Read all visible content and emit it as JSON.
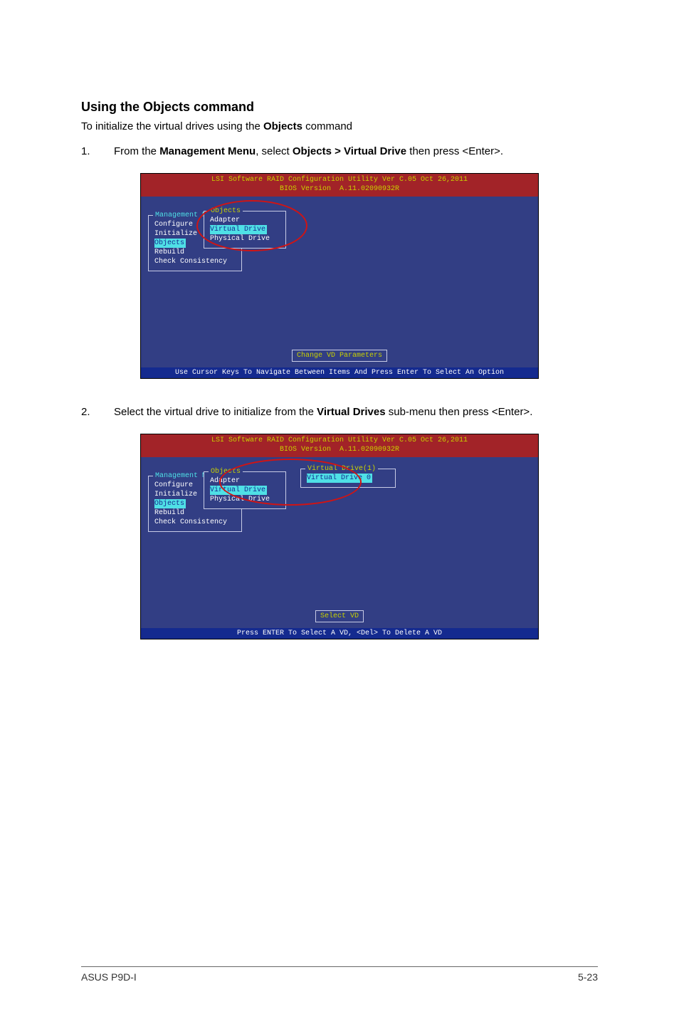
{
  "heading": "Using the Objects command",
  "intro_pre": "To initialize the virtual drives using the ",
  "intro_bold": "Objects",
  "intro_post": " command",
  "step1": {
    "num": "1.",
    "t1": "From the ",
    "b1": "Management Menu",
    "t2": ", select ",
    "b2": "Objects > Virtual Drive",
    "t3": " then press <Enter>."
  },
  "step2": {
    "num": "2.",
    "t1": "Select the virtual drive to initialize from the ",
    "b1": "Virtual Drives",
    "t2": " sub-menu then press <Enter>."
  },
  "bios": {
    "title_line1": "LSI Software RAID Configuration Utility Ver C.05 Oct 26,2011",
    "title_line2": "BIOS Version  A.11.02090932R",
    "mgmt_title": "Management Menu",
    "mgmt_items": {
      "configure": "Configure",
      "initialize": "Initialize",
      "objects": "Objects",
      "rebuild": "Rebuild",
      "check": "Check Consistency"
    },
    "objects_title": "Objects",
    "objects_items": {
      "adapter": "Adapter",
      "virtual_drive": "Virtual Drive",
      "physical_drive": "Physical Drive"
    },
    "vd_title": "Virtual Drive(1)",
    "vd_item": "Virtual Drive 0",
    "hint1": "Change VD Parameters",
    "footer1": "Use Cursor Keys To Navigate Between Items And Press Enter To Select An Option",
    "hint2": "Select VD",
    "footer2": "Press ENTER To Select A VD, <Del> To Delete A VD"
  },
  "footer": {
    "left": "ASUS P9D-I",
    "right": "5-23"
  }
}
